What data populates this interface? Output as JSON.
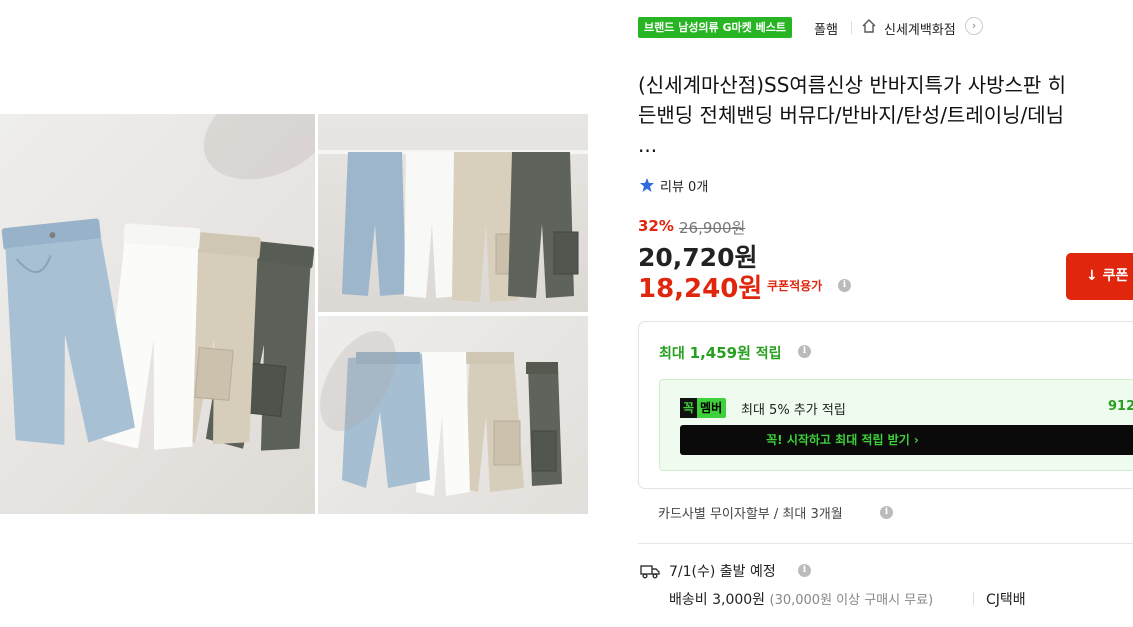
{
  "badges": {
    "best_badge": "브랜드 남성의류 G마켓 베스트",
    "store_type": "폴햄",
    "store_name": "신세계백화점",
    "store_arrow": "›"
  },
  "product": {
    "title_lines": [
      "(신세계마산점)SS여름신상 반바지특가 사방스판 히",
      "든밴딩 전체밴딩 버뮤다/반바지/탄성/트레이닝/데님",
      "..."
    ],
    "review_label": "리뷰 0개"
  },
  "price": {
    "discount": "32%",
    "original": "26,900원",
    "sale": "20,720원",
    "coupon_price": "18,240원",
    "coupon_label": "쿠폰적용가",
    "coupon_button": "↓ 쿠폰"
  },
  "reward": {
    "title_prefix": "최대 ",
    "title_amount": "1,459원",
    "title_suffix": " 적립",
    "member_logo_block": "꼭",
    "member_logo_text": "멤버",
    "member_text": "최대 5% 추가 적립",
    "member_amount": "912",
    "member_cta": "꼭! 시작하고 최대 적립 받기  ›"
  },
  "installment": "카드사별 무이자할부 / 최대 3개월",
  "shipping": {
    "date": "7/1(수) 출발 예정",
    "fee": "배송비 3,000원",
    "fee_note": "(30,000원 이상 구매시 무료)",
    "carrier": "CJ택배"
  },
  "info_icon": "i",
  "colors": {
    "accent_red": "#e0260d",
    "accent_green": "#27b524",
    "member_green": "#3fd13a"
  }
}
